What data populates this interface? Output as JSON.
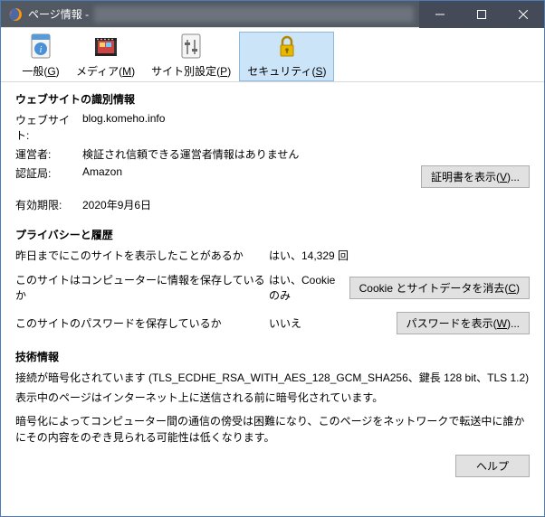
{
  "window": {
    "title": "ページ情報 -"
  },
  "tabs": {
    "general": "一般(G)",
    "media": "メディア(M)",
    "permissions": "サイト別設定(P)",
    "security": "セキュリティ(S)"
  },
  "identity": {
    "heading": "ウェブサイトの識別情報",
    "website_label": "ウェブサイト:",
    "website_value": "blog.komeho.info",
    "owner_label": "運営者:",
    "owner_value": "検証され信頼できる運営者情報はありません",
    "ca_label": "認証局:",
    "ca_value": "Amazon",
    "expiry_label": "有効期限:",
    "expiry_value": "2020年9月6日",
    "view_cert_btn": "証明書を表示(V)..."
  },
  "privacy": {
    "heading": "プライバシーと履歴",
    "q_history": "昨日までにこのサイトを表示したことがあるか",
    "a_history": "はい、14,329 回",
    "q_storage": "このサイトはコンピューターに情報を保存しているか",
    "a_storage": "はい、Cookie のみ",
    "clear_btn": "Cookie とサイトデータを消去(C)",
    "q_password": "このサイトのパスワードを保存しているか",
    "a_password": "いいえ",
    "pwd_btn": "パスワードを表示(W)..."
  },
  "tech": {
    "heading": "技術情報",
    "line1": "接続が暗号化されています (TLS_ECDHE_RSA_WITH_AES_128_GCM_SHA256、鍵長 128 bit、TLS 1.2)",
    "line2": "表示中のページはインターネット上に送信される前に暗号化されています。",
    "line3": "暗号化によってコンピューター間の通信の傍受は困難になり、このページをネットワークで転送中に誰かにその内容をのぞき見られる可能性は低くなります。",
    "help_btn": "ヘルプ"
  }
}
